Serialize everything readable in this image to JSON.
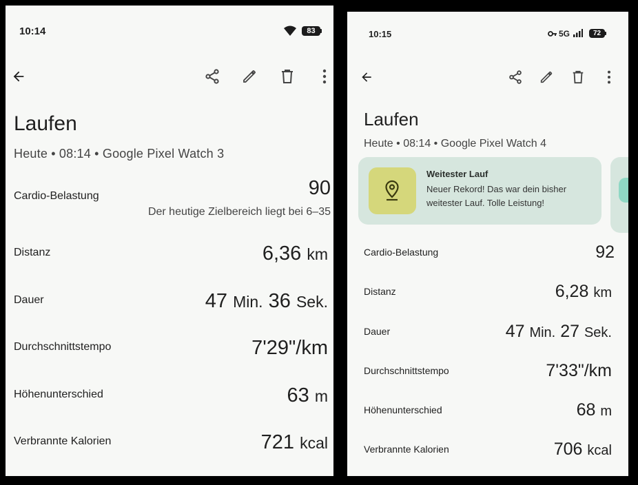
{
  "left": {
    "status": {
      "time": "10:14",
      "battery": "83"
    },
    "title": "Laufen",
    "subtitle": "Heute • 08:14 • Google Pixel Watch 3",
    "cardio": {
      "label": "Cardio-Belastung",
      "value": "90",
      "note": "Der heutige Zielbereich liegt bei 6–35"
    },
    "rows": [
      {
        "label": "Distanz",
        "value": "6,36",
        "unit": "km"
      },
      {
        "label": "Dauer",
        "v1": "47",
        "u1": "Min.",
        "v2": "36",
        "u2": "Sek."
      },
      {
        "label": "Durchschnittstempo",
        "value": "7'29\"/km"
      },
      {
        "label": "Höhenunterschied",
        "value": "63",
        "unit": "m"
      },
      {
        "label": "Verbrannte Kalorien",
        "value": "721",
        "unit": "kcal"
      }
    ]
  },
  "right": {
    "status": {
      "time": "10:15",
      "network": "5G",
      "battery": "72"
    },
    "title": "Laufen",
    "subtitle": "Heute • 08:14 • Google Pixel Watch 4",
    "card": {
      "title": "Weitester Lauf",
      "line1": "Neuer Rekord! Das war dein bisher",
      "line2": "weitester Lauf. Tolle Leistung!"
    },
    "rows": [
      {
        "label": "Cardio-Belastung",
        "value": "92"
      },
      {
        "label": "Distanz",
        "value": "6,28",
        "unit": "km"
      },
      {
        "label": "Dauer",
        "v1": "47",
        "u1": "Min.",
        "v2": "27",
        "u2": "Sek."
      },
      {
        "label": "Durchschnittstempo",
        "value": "7'33\"/km"
      },
      {
        "label": "Höhenunterschied",
        "value": "68",
        "unit": "m"
      },
      {
        "label": "Verbrannte Kalorien",
        "value": "706",
        "unit": "kcal"
      }
    ]
  }
}
